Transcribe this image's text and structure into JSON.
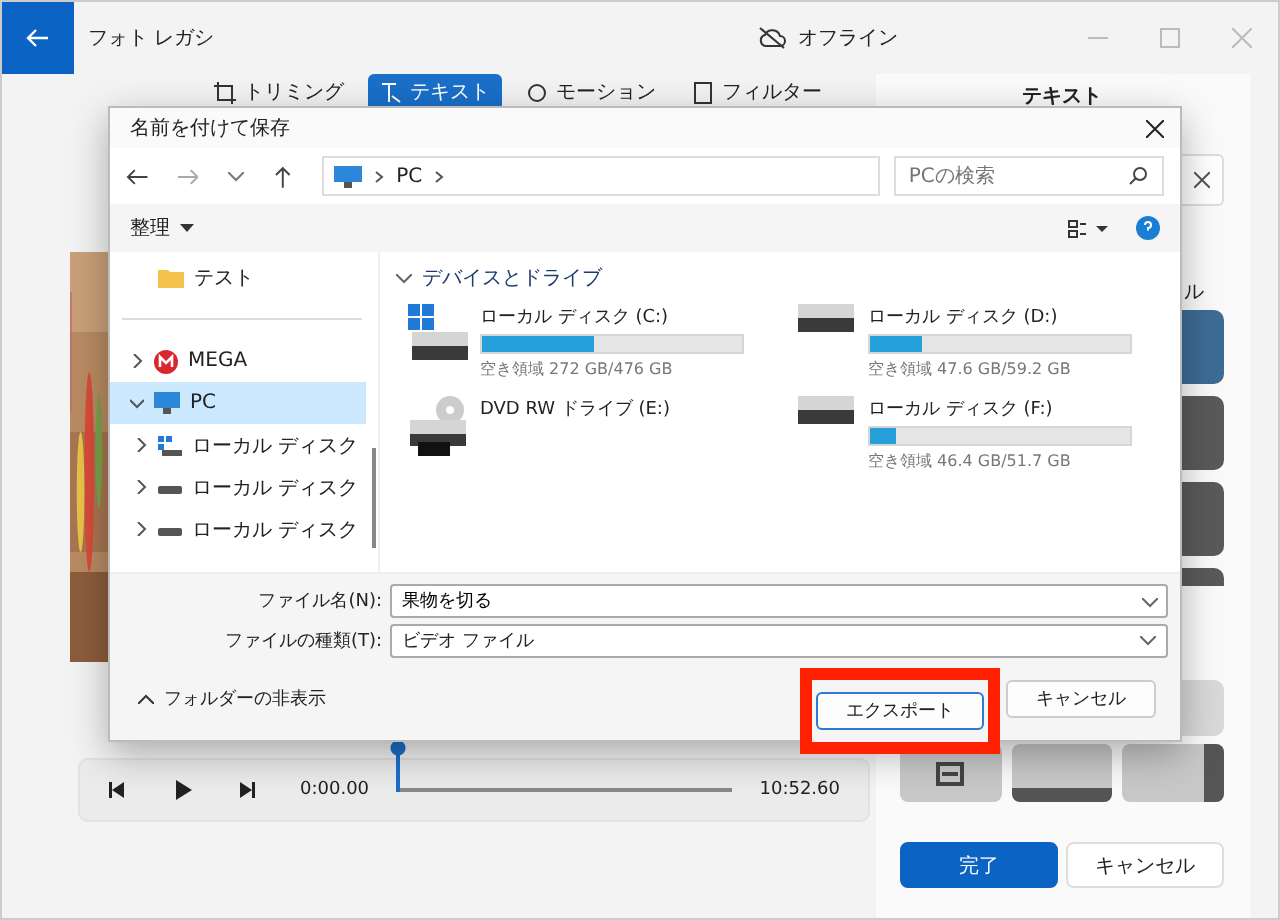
{
  "window": {
    "title": "フォト レガシ",
    "status": "オフライン"
  },
  "tabs": [
    {
      "label": "トリミング",
      "selected": false
    },
    {
      "label": "テキスト",
      "selected": true
    },
    {
      "label": "モーション",
      "selected": false
    },
    {
      "label": "フィルター",
      "selected": false
    }
  ],
  "side_panel": {
    "title": "テキスト",
    "partial_label": "ル",
    "styles": [
      {
        "selected": true
      },
      {
        "selected": false
      },
      {
        "selected": false
      },
      {
        "selected": false
      }
    ],
    "layouts": [
      {
        "kind": "center"
      },
      {
        "kind": "bottom"
      },
      {
        "kind": "right"
      }
    ],
    "buttons": [
      {
        "label": "完了",
        "primary": true
      },
      {
        "label": "キャンセル",
        "primary": false
      }
    ]
  },
  "player": {
    "level": 0,
    "current_time": "0:00.00",
    "end_time": "10:52.60"
  },
  "dialog": {
    "title": "名前を付けて保存",
    "address": [
      "PC"
    ],
    "search": {
      "placeholder": "PCの検索"
    },
    "organize": "整理",
    "quick_access": [
      {
        "label": "テスト"
      }
    ],
    "tree": [
      {
        "label": "MEGA",
        "kind": "mega",
        "expanded": false,
        "selected": false
      },
      {
        "label": "PC",
        "kind": "pc",
        "expanded": true,
        "selected": true,
        "children": [
          {
            "label": "ローカル ディスク",
            "kind": "system",
            "expanded": false,
            "selected": false
          },
          {
            "label": "ローカル ディスク",
            "kind": "drive",
            "expanded": false,
            "selected": false
          },
          {
            "label": "ローカル ディスク",
            "kind": "drive",
            "expanded": false,
            "selected": false
          }
        ]
      }
    ],
    "group": "デバイスとドライブ",
    "drives": [
      {
        "name": "ローカル ディスク (C:)",
        "kind": "system",
        "level": 0.43,
        "free": "空き領域 272 GB/476 GB"
      },
      {
        "name": "ローカル ディスク (D:)",
        "kind": "drive",
        "level": 0.2,
        "free": "空き領域 47.6 GB/59.2 GB"
      },
      {
        "name": "DVD RW ドライブ (E:)",
        "kind": "dvd"
      },
      {
        "name": "ローカル ディスク (F:)",
        "kind": "drive",
        "level": 0.1,
        "free": "空き領域 46.4 GB/51.7 GB"
      }
    ],
    "filename": {
      "label": "ファイル名(N):",
      "value": "果物を切る"
    },
    "filetype": {
      "label": "ファイルの種類(T):",
      "value": "ビデオ ファイル"
    },
    "hide_folders": "フォルダーの非表示",
    "buttons": [
      {
        "label": "エクスポート",
        "primary": true,
        "highlighted": true
      },
      {
        "label": "キャンセル",
        "primary": false,
        "highlighted": false
      }
    ]
  }
}
